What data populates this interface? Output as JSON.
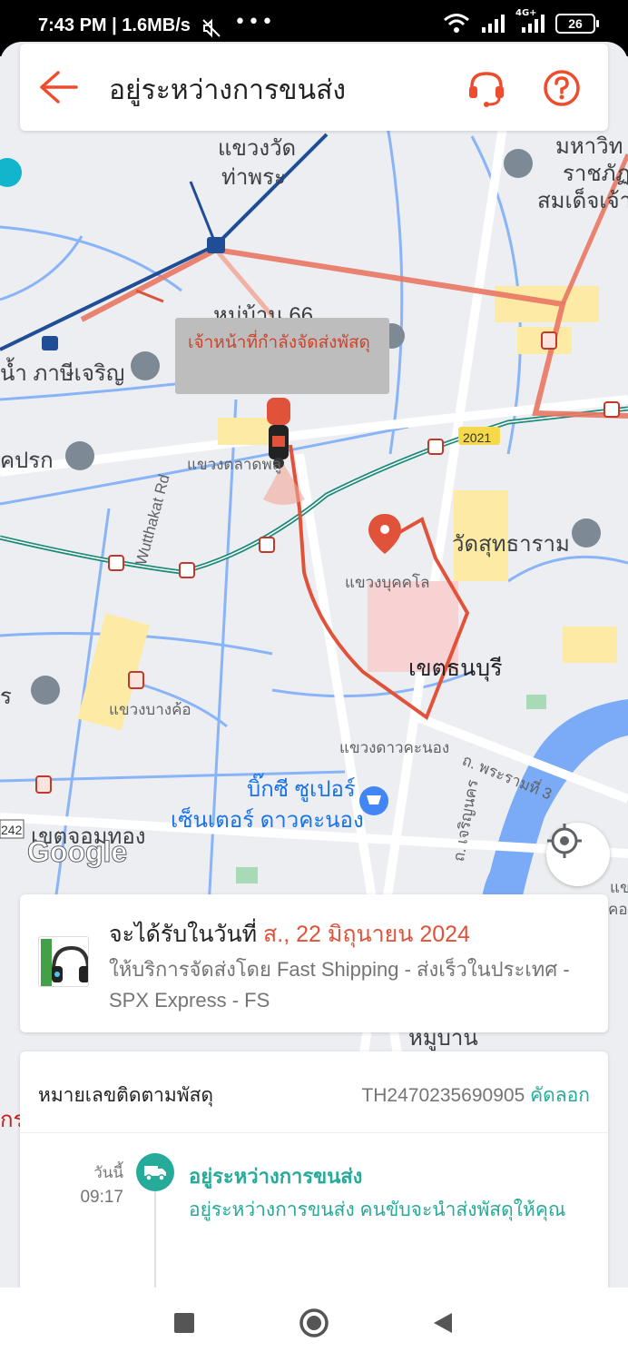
{
  "status_bar": {
    "time": "7:43 PM | 1.6MB/s",
    "battery": "26",
    "network": "4G+"
  },
  "header": {
    "title": "อยู่ระหว่างการขนส่ง",
    "back_icon": "arrow-left-icon",
    "support_icon": "headset-icon",
    "help_icon": "question-icon",
    "accent_color": "#ee4d2d"
  },
  "map": {
    "courier_tooltip": "เจ้าหน้าที่กำลังจัดส่งพัสดุ",
    "labels": {
      "wat_tha_phra_1": "แขวงวัด",
      "wat_tha_phra_2": "ท่าพระ",
      "mahawit_1": "มหาวิท",
      "mahawit_2": "ราชภัฏ",
      "mahawit_3": "สมเด็จเจ้า",
      "moo_ban_66": "หมู่บ้าน 66",
      "phasi_charoen": "น้ำ ภาษีเจริญ",
      "khon_prok": "คปรก",
      "talat_phlu": "แขวงตลาดพลู",
      "wutthakat": "Wutthakat Rd",
      "wat_sutharam": "วัดสุทธาราม",
      "bukkhalo": "แขวงบุคคโล",
      "khet_thonburi": "เขตธนบุรี",
      "bang_kho": "แขวงบางค้อ",
      "dao_khanong": "แขวงดาวคะนอง",
      "rama3": "ถ. พระรามที่ 3",
      "big_c_1": "บิ๊กซี ซูเปอร์",
      "big_c_2": "เซ็นเตอร์ ดาวคะนอง",
      "chom_thong": "เขตจอมทอง",
      "charoen_nakhon": "ถ. เจริญนคร",
      "road_2021": "2021",
      "road_242": "242",
      "moo_ban": "หมู่บ้าน",
      "krung": "กร",
      "khet_right": "แข",
      "kho_right": "คอ",
      "rat_left": "ร"
    },
    "google_logo": "Google",
    "locate_icon": "crosshair-icon",
    "route_color": "#e0533a"
  },
  "delivery": {
    "est_prefix": "จะได้รับในวันที่ ",
    "est_date": "ส., 22 มิถุนายน 2024",
    "service": "ให้บริการจัดส่งโดย Fast Shipping - ส่งเร็วในประเทศ - SPX Express - FS",
    "thumb_icon": "headphones-product-icon"
  },
  "tracking": {
    "label": "หมายเลขติดตามพัสดุ",
    "number": "TH2470235690905",
    "copy": "คัดลอก",
    "events": [
      {
        "date": "วันนี้",
        "time": "09:17",
        "title": "อยู่ระหว่างการขนส่ง",
        "desc": "อยู่ระหว่างการขนส่ง คนขับจะนำส่งพัสดุให้คุณ",
        "icon": "truck-icon"
      }
    ],
    "accent_color": "#26aa99"
  },
  "navbar": {
    "recents_icon": "square-icon",
    "home_icon": "circle-icon",
    "back_icon": "triangle-back-icon"
  }
}
